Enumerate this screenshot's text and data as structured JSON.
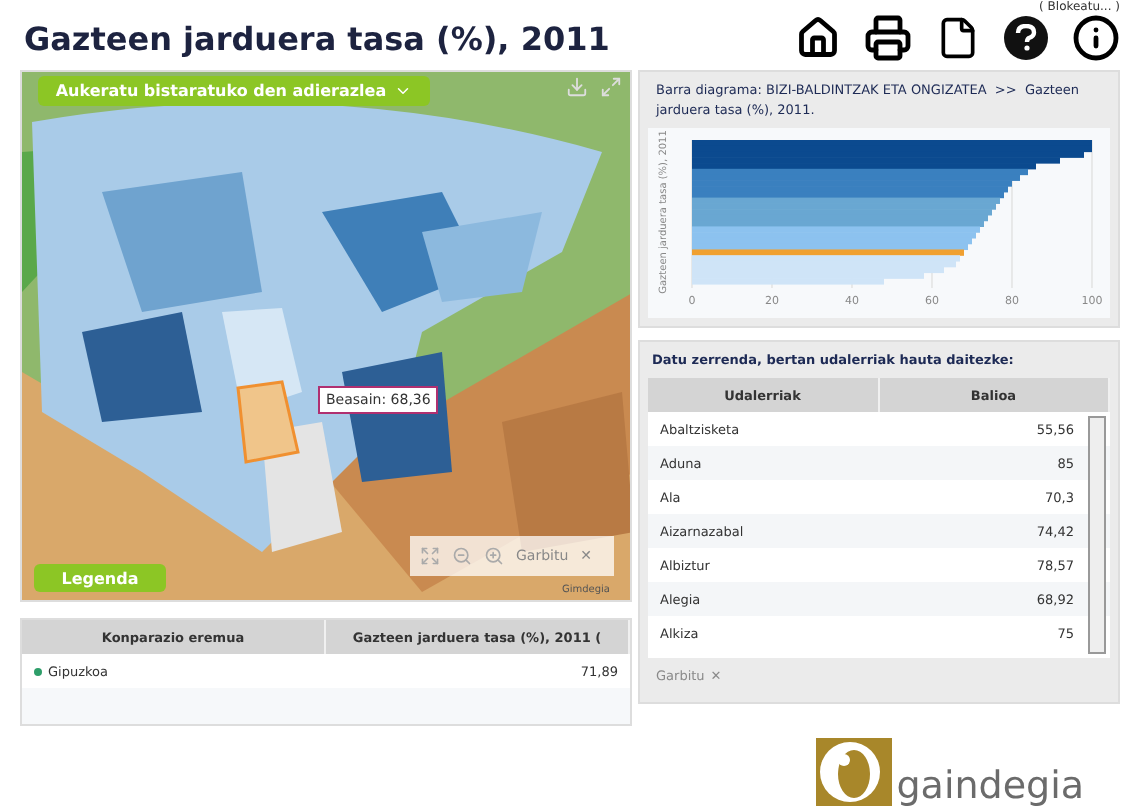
{
  "title": "Gazteen jarduera tasa (%), 2011",
  "lock_link": "( Blokeatu... )",
  "map": {
    "indicator_button": "Aukeratu bistaratuko den adierazlea",
    "tooltip": "Beasain: 68,36",
    "legend_button": "Legenda",
    "clear_button": "Garbitu",
    "clear_icon": "✕",
    "attribution": "Gimdegia"
  },
  "comparison_table": {
    "columns": [
      "Konparazio eremua",
      "Gazteen jarduera tasa (%), 2011 ("
    ],
    "rows": [
      {
        "name": "Gipuzkoa",
        "value": "71,89",
        "color": "#2e9e6a"
      }
    ]
  },
  "bar_panel": {
    "heading": "Barra diagrama: BIZI-BALDINTZAK ETA ONGIZATEA  >>  Gazteen jarduera tasa (%), 2011.",
    "chart_data": {
      "type": "bar",
      "orientation": "horizontal",
      "grid": true,
      "ylabel": "Gazteen jarduera tasa (%), 2011",
      "xlim": [
        0,
        100
      ],
      "xticks": [
        0,
        20,
        40,
        60,
        80,
        100
      ],
      "series": [
        {
          "color": "#0b4a8f",
          "values": [
            100,
            100,
            98,
            92,
            86,
            null,
            null,
            null,
            null,
            null,
            null,
            null,
            null,
            null,
            null,
            null,
            null,
            null,
            null,
            null,
            null,
            null,
            null,
            null,
            null
          ]
        },
        {
          "color": "#3a80bf",
          "values": [
            null,
            null,
            null,
            null,
            null,
            84,
            82,
            80,
            79,
            78,
            null,
            null,
            null,
            null,
            null,
            null,
            null,
            null,
            null,
            null,
            null,
            null,
            null,
            null,
            null
          ]
        },
        {
          "color": "#69a7d2",
          "values": [
            null,
            null,
            null,
            null,
            null,
            null,
            null,
            null,
            null,
            null,
            77,
            76,
            75,
            74,
            73,
            null,
            null,
            null,
            null,
            null,
            null,
            null,
            null,
            null,
            null
          ]
        },
        {
          "color": "#8cc2ef",
          "values": [
            null,
            null,
            null,
            null,
            null,
            null,
            null,
            null,
            null,
            null,
            null,
            null,
            null,
            null,
            null,
            72,
            71,
            70,
            69,
            null,
            null,
            null,
            null,
            null,
            null
          ]
        },
        {
          "color": "#f0a030",
          "values": [
            null,
            null,
            null,
            null,
            null,
            null,
            null,
            null,
            null,
            null,
            null,
            null,
            null,
            null,
            null,
            null,
            null,
            null,
            null,
            68,
            null,
            null,
            null,
            null,
            null
          ]
        },
        {
          "color": "#cfe4f7",
          "values": [
            null,
            null,
            null,
            null,
            null,
            null,
            null,
            null,
            null,
            null,
            null,
            null,
            null,
            null,
            null,
            null,
            null,
            null,
            null,
            null,
            67,
            66,
            63,
            58,
            48
          ]
        }
      ]
    }
  },
  "data_list": {
    "heading": "Datu zerrenda, bertan udalerriak hauta daitezke:",
    "columns": [
      "Udalerriak",
      "Balioa"
    ],
    "rows": [
      {
        "name": "Abaltzisketa",
        "value": "55,56"
      },
      {
        "name": "Aduna",
        "value": "85"
      },
      {
        "name": "Ala",
        "value": "70,3"
      },
      {
        "name": "Aizarnazabal",
        "value": "74,42"
      },
      {
        "name": "Albiztur",
        "value": "78,57"
      },
      {
        "name": "Alegia",
        "value": "68,92"
      },
      {
        "name": "Alkiza",
        "value": "75"
      }
    ],
    "clear_button": "Garbitu",
    "clear_icon": "✕",
    "clear_disabled": true
  },
  "logo": "gaindegia"
}
